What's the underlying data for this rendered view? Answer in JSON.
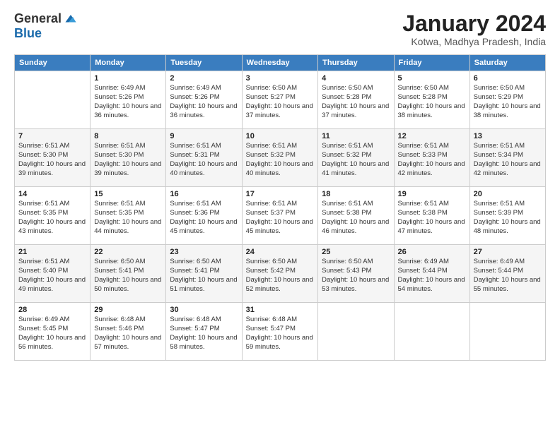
{
  "logo": {
    "general": "General",
    "blue": "Blue"
  },
  "title": "January 2024",
  "subtitle": "Kotwa, Madhya Pradesh, India",
  "headers": [
    "Sunday",
    "Monday",
    "Tuesday",
    "Wednesday",
    "Thursday",
    "Friday",
    "Saturday"
  ],
  "weeks": [
    [
      {
        "day": "",
        "empty": true
      },
      {
        "day": "1",
        "sunrise": "Sunrise: 6:49 AM",
        "sunset": "Sunset: 5:26 PM",
        "daylight": "Daylight: 10 hours and 36 minutes."
      },
      {
        "day": "2",
        "sunrise": "Sunrise: 6:49 AM",
        "sunset": "Sunset: 5:26 PM",
        "daylight": "Daylight: 10 hours and 36 minutes."
      },
      {
        "day": "3",
        "sunrise": "Sunrise: 6:50 AM",
        "sunset": "Sunset: 5:27 PM",
        "daylight": "Daylight: 10 hours and 37 minutes."
      },
      {
        "day": "4",
        "sunrise": "Sunrise: 6:50 AM",
        "sunset": "Sunset: 5:28 PM",
        "daylight": "Daylight: 10 hours and 37 minutes."
      },
      {
        "day": "5",
        "sunrise": "Sunrise: 6:50 AM",
        "sunset": "Sunset: 5:28 PM",
        "daylight": "Daylight: 10 hours and 38 minutes."
      },
      {
        "day": "6",
        "sunrise": "Sunrise: 6:50 AM",
        "sunset": "Sunset: 5:29 PM",
        "daylight": "Daylight: 10 hours and 38 minutes."
      }
    ],
    [
      {
        "day": "7",
        "sunrise": "Sunrise: 6:51 AM",
        "sunset": "Sunset: 5:30 PM",
        "daylight": "Daylight: 10 hours and 39 minutes."
      },
      {
        "day": "8",
        "sunrise": "Sunrise: 6:51 AM",
        "sunset": "Sunset: 5:30 PM",
        "daylight": "Daylight: 10 hours and 39 minutes."
      },
      {
        "day": "9",
        "sunrise": "Sunrise: 6:51 AM",
        "sunset": "Sunset: 5:31 PM",
        "daylight": "Daylight: 10 hours and 40 minutes."
      },
      {
        "day": "10",
        "sunrise": "Sunrise: 6:51 AM",
        "sunset": "Sunset: 5:32 PM",
        "daylight": "Daylight: 10 hours and 40 minutes."
      },
      {
        "day": "11",
        "sunrise": "Sunrise: 6:51 AM",
        "sunset": "Sunset: 5:32 PM",
        "daylight": "Daylight: 10 hours and 41 minutes."
      },
      {
        "day": "12",
        "sunrise": "Sunrise: 6:51 AM",
        "sunset": "Sunset: 5:33 PM",
        "daylight": "Daylight: 10 hours and 42 minutes."
      },
      {
        "day": "13",
        "sunrise": "Sunrise: 6:51 AM",
        "sunset": "Sunset: 5:34 PM",
        "daylight": "Daylight: 10 hours and 42 minutes."
      }
    ],
    [
      {
        "day": "14",
        "sunrise": "Sunrise: 6:51 AM",
        "sunset": "Sunset: 5:35 PM",
        "daylight": "Daylight: 10 hours and 43 minutes."
      },
      {
        "day": "15",
        "sunrise": "Sunrise: 6:51 AM",
        "sunset": "Sunset: 5:35 PM",
        "daylight": "Daylight: 10 hours and 44 minutes."
      },
      {
        "day": "16",
        "sunrise": "Sunrise: 6:51 AM",
        "sunset": "Sunset: 5:36 PM",
        "daylight": "Daylight: 10 hours and 45 minutes."
      },
      {
        "day": "17",
        "sunrise": "Sunrise: 6:51 AM",
        "sunset": "Sunset: 5:37 PM",
        "daylight": "Daylight: 10 hours and 45 minutes."
      },
      {
        "day": "18",
        "sunrise": "Sunrise: 6:51 AM",
        "sunset": "Sunset: 5:38 PM",
        "daylight": "Daylight: 10 hours and 46 minutes."
      },
      {
        "day": "19",
        "sunrise": "Sunrise: 6:51 AM",
        "sunset": "Sunset: 5:38 PM",
        "daylight": "Daylight: 10 hours and 47 minutes."
      },
      {
        "day": "20",
        "sunrise": "Sunrise: 6:51 AM",
        "sunset": "Sunset: 5:39 PM",
        "daylight": "Daylight: 10 hours and 48 minutes."
      }
    ],
    [
      {
        "day": "21",
        "sunrise": "Sunrise: 6:51 AM",
        "sunset": "Sunset: 5:40 PM",
        "daylight": "Daylight: 10 hours and 49 minutes."
      },
      {
        "day": "22",
        "sunrise": "Sunrise: 6:50 AM",
        "sunset": "Sunset: 5:41 PM",
        "daylight": "Daylight: 10 hours and 50 minutes."
      },
      {
        "day": "23",
        "sunrise": "Sunrise: 6:50 AM",
        "sunset": "Sunset: 5:41 PM",
        "daylight": "Daylight: 10 hours and 51 minutes."
      },
      {
        "day": "24",
        "sunrise": "Sunrise: 6:50 AM",
        "sunset": "Sunset: 5:42 PM",
        "daylight": "Daylight: 10 hours and 52 minutes."
      },
      {
        "day": "25",
        "sunrise": "Sunrise: 6:50 AM",
        "sunset": "Sunset: 5:43 PM",
        "daylight": "Daylight: 10 hours and 53 minutes."
      },
      {
        "day": "26",
        "sunrise": "Sunrise: 6:49 AM",
        "sunset": "Sunset: 5:44 PM",
        "daylight": "Daylight: 10 hours and 54 minutes."
      },
      {
        "day": "27",
        "sunrise": "Sunrise: 6:49 AM",
        "sunset": "Sunset: 5:44 PM",
        "daylight": "Daylight: 10 hours and 55 minutes."
      }
    ],
    [
      {
        "day": "28",
        "sunrise": "Sunrise: 6:49 AM",
        "sunset": "Sunset: 5:45 PM",
        "daylight": "Daylight: 10 hours and 56 minutes."
      },
      {
        "day": "29",
        "sunrise": "Sunrise: 6:48 AM",
        "sunset": "Sunset: 5:46 PM",
        "daylight": "Daylight: 10 hours and 57 minutes."
      },
      {
        "day": "30",
        "sunrise": "Sunrise: 6:48 AM",
        "sunset": "Sunset: 5:47 PM",
        "daylight": "Daylight: 10 hours and 58 minutes."
      },
      {
        "day": "31",
        "sunrise": "Sunrise: 6:48 AM",
        "sunset": "Sunset: 5:47 PM",
        "daylight": "Daylight: 10 hours and 59 minutes."
      },
      {
        "day": "",
        "empty": true
      },
      {
        "day": "",
        "empty": true
      },
      {
        "day": "",
        "empty": true
      }
    ]
  ]
}
